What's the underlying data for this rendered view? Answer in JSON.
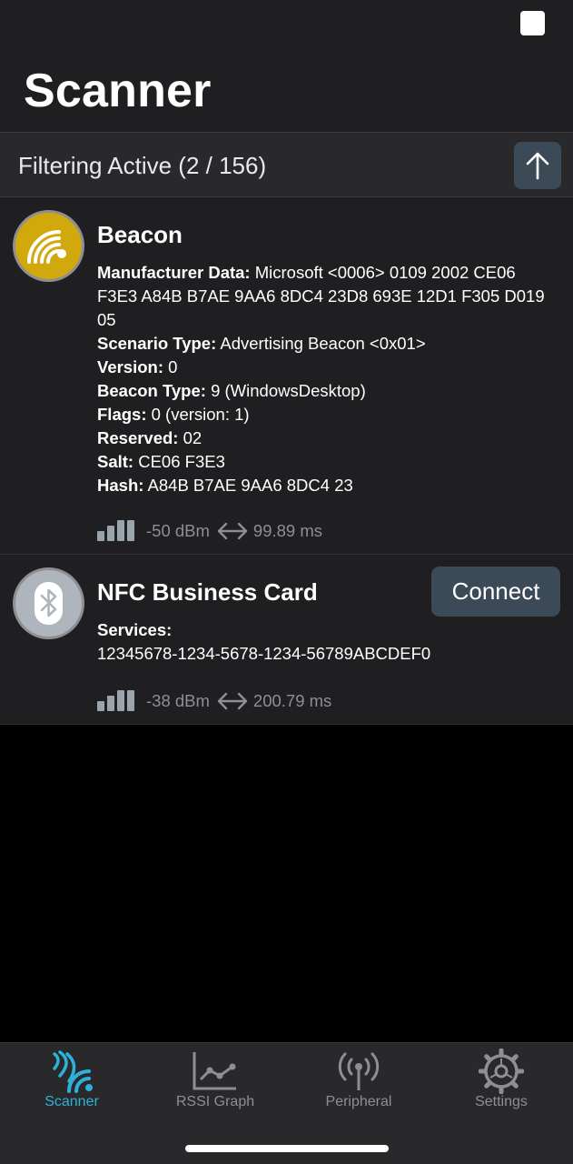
{
  "header": {
    "title": "Scanner",
    "corner_control": "checkbox"
  },
  "filter_bar": {
    "text": "Filtering Active (2 / 156)",
    "scroll_top_icon": "arrow-up-icon"
  },
  "devices": [
    {
      "name": "Beacon",
      "icon": "wifi-broadcast-icon",
      "icon_color": "#d2a90d",
      "details": [
        {
          "label": "Manufacturer Data:",
          "value": " Microsoft <0006> 0109 2002 CE06 F3E3 A84B B7AE 9AA6 8DC4 23D8 693E 12D1 F305 D019 05"
        },
        {
          "label": "Scenario Type:",
          "value": " Advertising Beacon <0x01>"
        },
        {
          "label": "Version:",
          "value": " 0"
        },
        {
          "label": "Beacon Type:",
          "value": " 9 (WindowsDesktop)"
        },
        {
          "label": "Flags:",
          "value": " 0 (version: 1)"
        },
        {
          "label": "Reserved:",
          "value": " 02"
        },
        {
          "label": "Salt:",
          "value": " CE06 F3E3"
        },
        {
          "label": "Hash:",
          "value": " A84B B7AE 9AA6 8DC4 23"
        }
      ],
      "rssi": "-50 dBm",
      "interval": "99.89 ms"
    },
    {
      "name": "NFC Business Card",
      "icon": "bluetooth-icon",
      "icon_color": "#aeb5bd",
      "connect_label": "Connect",
      "details": [
        {
          "label": "Services:",
          "value": ""
        },
        {
          "label": "",
          "value": "12345678-1234-5678-1234-56789ABCDEF0"
        }
      ],
      "rssi": "-38 dBm",
      "interval": "200.79 ms"
    }
  ],
  "tabs": [
    {
      "label": "Scanner",
      "icon": "scanner-waves-icon",
      "active": true
    },
    {
      "label": "RSSI Graph",
      "icon": "line-graph-icon",
      "active": false
    },
    {
      "label": "Peripheral",
      "icon": "antenna-icon",
      "active": false
    },
    {
      "label": "Settings",
      "icon": "gear-icon",
      "active": false
    }
  ],
  "colors": {
    "accent": "#2eb1d8",
    "background": "#000000",
    "card": "#1f1f21",
    "button": "#3c4a57",
    "secondary_text": "#8e8e93"
  }
}
